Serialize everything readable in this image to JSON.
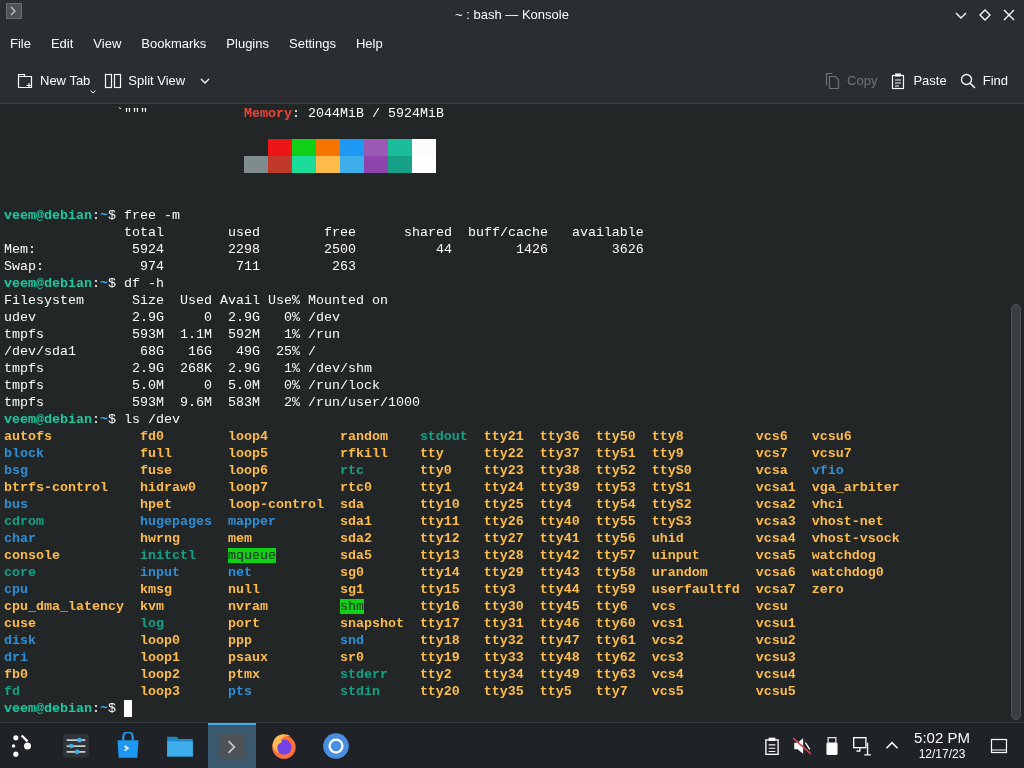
{
  "window": {
    "title": "~ : bash — Konsole"
  },
  "menu": [
    "File",
    "Edit",
    "View",
    "Bookmarks",
    "Plugins",
    "Settings",
    "Help"
  ],
  "toolbar": {
    "left": [
      {
        "label": "New Tab",
        "kind": "new-tab",
        "disabled": false
      },
      {
        "label": "Split View",
        "kind": "split-view",
        "disabled": false
      }
    ],
    "right": [
      {
        "label": "Copy",
        "kind": "copy",
        "disabled": true
      },
      {
        "label": "Paste",
        "kind": "paste",
        "disabled": false
      },
      {
        "label": "Find",
        "kind": "find",
        "disabled": false
      }
    ]
  },
  "terminal": {
    "lines": [
      {
        "kind": "info",
        "art": "`\"\"\"",
        "key": "Memory",
        "value": ": 2044MiB / 5924MiB"
      },
      {
        "kind": "blank"
      },
      {
        "kind": "palette",
        "rows": [
          [
            {
              "color": "#ed1515"
            },
            {
              "color": "#11d116"
            },
            {
              "color": "#f67400"
            },
            {
              "color": "#1d99f3"
            },
            {
              "color": "#9b59b6"
            },
            {
              "color": "#1abc9c"
            },
            {
              "color": "#fcfcfc"
            }
          ],
          [
            {
              "color": "#7f8c8d"
            },
            {
              "color": "#c0392b"
            },
            {
              "color": "#1cdc9a"
            },
            {
              "color": "#fdbc4b"
            },
            {
              "color": "#3daee9"
            },
            {
              "color": "#8e44ad"
            },
            {
              "color": "#16a085"
            },
            {
              "color": "#ffffff"
            }
          ]
        ]
      },
      {
        "kind": "blank"
      },
      {
        "kind": "blank"
      },
      {
        "kind": "prompt",
        "user": "veem@debian",
        "sep": ":",
        "path": "~",
        "symbol": "$",
        "command": "free -m",
        "cursor": false
      },
      {
        "kind": "output",
        "text": "               total        used        free      shared  buff/cache   available"
      },
      {
        "kind": "output",
        "text": "Mem:            5924        2298        2500          44        1426        3626"
      },
      {
        "kind": "output",
        "text": "Swap:            974         711         263"
      },
      {
        "kind": "prompt",
        "user": "veem@debian",
        "sep": ":",
        "path": "~",
        "symbol": "$",
        "command": "df -h",
        "cursor": false
      },
      {
        "kind": "output",
        "text": "Filesystem      Size  Used Avail Use% Mounted on"
      },
      {
        "kind": "output",
        "text": "udev            2.9G     0  2.9G   0% /dev"
      },
      {
        "kind": "output",
        "text": "tmpfs           593M  1.1M  592M   1% /run"
      },
      {
        "kind": "output",
        "text": "/dev/sda1        68G   16G   49G  25% /"
      },
      {
        "kind": "output",
        "text": "tmpfs           2.9G  268K  2.9G   1% /dev/shm"
      },
      {
        "kind": "output",
        "text": "tmpfs           5.0M     0  5.0M   0% /run/lock"
      },
      {
        "kind": "output",
        "text": "tmpfs           593M  9.6M  583M   2% /run/user/1000"
      },
      {
        "kind": "prompt",
        "user": "veem@debian",
        "sep": ":",
        "path": "~",
        "symbol": "$",
        "command": "ls /dev",
        "cursor": false
      },
      {
        "kind": "listing",
        "rows": [
          [
            {
              "name": "autofs",
              "kind": "dev"
            },
            {
              "name": "fd0",
              "kind": "dev"
            },
            {
              "name": "loop4",
              "kind": "dev"
            },
            {
              "name": "random",
              "kind": "dev"
            },
            {
              "name": "stdout",
              "kind": "link"
            },
            {
              "name": "tty21",
              "kind": "dev"
            },
            {
              "name": "tty36",
              "kind": "dev"
            },
            {
              "name": "tty50",
              "kind": "dev"
            },
            {
              "name": "tty8",
              "kind": "dev"
            },
            {
              "name": "vcs6",
              "kind": "dev"
            },
            {
              "name": "vcsu6",
              "kind": "dev"
            }
          ],
          [
            {
              "name": "block",
              "kind": "dir"
            },
            {
              "name": "full",
              "kind": "dev"
            },
            {
              "name": "loop5",
              "kind": "dev"
            },
            {
              "name": "rfkill",
              "kind": "dev"
            },
            {
              "name": "tty",
              "kind": "dev"
            },
            {
              "name": "tty22",
              "kind": "dev"
            },
            {
              "name": "tty37",
              "kind": "dev"
            },
            {
              "name": "tty51",
              "kind": "dev"
            },
            {
              "name": "tty9",
              "kind": "dev"
            },
            {
              "name": "vcs7",
              "kind": "dev"
            },
            {
              "name": "vcsu7",
              "kind": "dev"
            }
          ],
          [
            {
              "name": "bsg",
              "kind": "dir"
            },
            {
              "name": "fuse",
              "kind": "dev"
            },
            {
              "name": "loop6",
              "kind": "dev"
            },
            {
              "name": "rtc",
              "kind": "link"
            },
            {
              "name": "tty0",
              "kind": "dev"
            },
            {
              "name": "tty23",
              "kind": "dev"
            },
            {
              "name": "tty38",
              "kind": "dev"
            },
            {
              "name": "tty52",
              "kind": "dev"
            },
            {
              "name": "ttyS0",
              "kind": "dev"
            },
            {
              "name": "vcsa",
              "kind": "dev"
            },
            {
              "name": "vfio",
              "kind": "dir"
            }
          ],
          [
            {
              "name": "btrfs-control",
              "kind": "dev"
            },
            {
              "name": "hidraw0",
              "kind": "dev"
            },
            {
              "name": "loop7",
              "kind": "dev"
            },
            {
              "name": "rtc0",
              "kind": "dev"
            },
            {
              "name": "tty1",
              "kind": "dev"
            },
            {
              "name": "tty24",
              "kind": "dev"
            },
            {
              "name": "tty39",
              "kind": "dev"
            },
            {
              "name": "tty53",
              "kind": "dev"
            },
            {
              "name": "ttyS1",
              "kind": "dev"
            },
            {
              "name": "vcsa1",
              "kind": "dev"
            },
            {
              "name": "vga_arbiter",
              "kind": "dev"
            }
          ],
          [
            {
              "name": "bus",
              "kind": "dir"
            },
            {
              "name": "hpet",
              "kind": "dev"
            },
            {
              "name": "loop-control",
              "kind": "dev"
            },
            {
              "name": "sda",
              "kind": "dev"
            },
            {
              "name": "tty10",
              "kind": "dev"
            },
            {
              "name": "tty25",
              "kind": "dev"
            },
            {
              "name": "tty4",
              "kind": "dev"
            },
            {
              "name": "tty54",
              "kind": "dev"
            },
            {
              "name": "ttyS2",
              "kind": "dev"
            },
            {
              "name": "vcsa2",
              "kind": "dev"
            },
            {
              "name": "vhci",
              "kind": "dev"
            }
          ],
          [
            {
              "name": "cdrom",
              "kind": "link"
            },
            {
              "name": "hugepages",
              "kind": "dir"
            },
            {
              "name": "mapper",
              "kind": "dir"
            },
            {
              "name": "sda1",
              "kind": "dev"
            },
            {
              "name": "tty11",
              "kind": "dev"
            },
            {
              "name": "tty26",
              "kind": "dev"
            },
            {
              "name": "tty40",
              "kind": "dev"
            },
            {
              "name": "tty55",
              "kind": "dev"
            },
            {
              "name": "ttyS3",
              "kind": "dev"
            },
            {
              "name": "vcsa3",
              "kind": "dev"
            },
            {
              "name": "vhost-net",
              "kind": "dev"
            }
          ],
          [
            {
              "name": "char",
              "kind": "dir"
            },
            {
              "name": "hwrng",
              "kind": "dev"
            },
            {
              "name": "mem",
              "kind": "dev"
            },
            {
              "name": "sda2",
              "kind": "dev"
            },
            {
              "name": "tty12",
              "kind": "dev"
            },
            {
              "name": "tty27",
              "kind": "dev"
            },
            {
              "name": "tty41",
              "kind": "dev"
            },
            {
              "name": "tty56",
              "kind": "dev"
            },
            {
              "name": "uhid",
              "kind": "dev"
            },
            {
              "name": "vcsa4",
              "kind": "dev"
            },
            {
              "name": "vhost-vsock",
              "kind": "dev"
            }
          ],
          [
            {
              "name": "console",
              "kind": "dev"
            },
            {
              "name": "initctl",
              "kind": "link"
            },
            {
              "name": "mqueue",
              "kind": "sticky"
            },
            {
              "name": "sda5",
              "kind": "dev"
            },
            {
              "name": "tty13",
              "kind": "dev"
            },
            {
              "name": "tty28",
              "kind": "dev"
            },
            {
              "name": "tty42",
              "kind": "dev"
            },
            {
              "name": "tty57",
              "kind": "dev"
            },
            {
              "name": "uinput",
              "kind": "dev"
            },
            {
              "name": "vcsa5",
              "kind": "dev"
            },
            {
              "name": "watchdog",
              "kind": "dev"
            }
          ],
          [
            {
              "name": "core",
              "kind": "link"
            },
            {
              "name": "input",
              "kind": "dir"
            },
            {
              "name": "net",
              "kind": "dir"
            },
            {
              "name": "sg0",
              "kind": "dev"
            },
            {
              "name": "tty14",
              "kind": "dev"
            },
            {
              "name": "tty29",
              "kind": "dev"
            },
            {
              "name": "tty43",
              "kind": "dev"
            },
            {
              "name": "tty58",
              "kind": "dev"
            },
            {
              "name": "urandom",
              "kind": "dev"
            },
            {
              "name": "vcsa6",
              "kind": "dev"
            },
            {
              "name": "watchdog0",
              "kind": "dev"
            }
          ],
          [
            {
              "name": "cpu",
              "kind": "dir"
            },
            {
              "name": "kmsg",
              "kind": "dev"
            },
            {
              "name": "null",
              "kind": "dev"
            },
            {
              "name": "sg1",
              "kind": "dev"
            },
            {
              "name": "tty15",
              "kind": "dev"
            },
            {
              "name": "tty3",
              "kind": "dev"
            },
            {
              "name": "tty44",
              "kind": "dev"
            },
            {
              "name": "tty59",
              "kind": "dev"
            },
            {
              "name": "userfaultfd",
              "kind": "dev"
            },
            {
              "name": "vcsa7",
              "kind": "dev"
            },
            {
              "name": "zero",
              "kind": "dev"
            }
          ],
          [
            {
              "name": "cpu_dma_latency",
              "kind": "dev"
            },
            {
              "name": "kvm",
              "kind": "dev"
            },
            {
              "name": "nvram",
              "kind": "dev"
            },
            {
              "name": "shm",
              "kind": "sticky"
            },
            {
              "name": "tty16",
              "kind": "dev"
            },
            {
              "name": "tty30",
              "kind": "dev"
            },
            {
              "name": "tty45",
              "kind": "dev"
            },
            {
              "name": "tty6",
              "kind": "dev"
            },
            {
              "name": "vcs",
              "kind": "dev"
            },
            {
              "name": "vcsu",
              "kind": "dev"
            }
          ],
          [
            {
              "name": "cuse",
              "kind": "dev"
            },
            {
              "name": "log",
              "kind": "link"
            },
            {
              "name": "port",
              "kind": "dev"
            },
            {
              "name": "snapshot",
              "kind": "dev"
            },
            {
              "name": "tty17",
              "kind": "dev"
            },
            {
              "name": "tty31",
              "kind": "dev"
            },
            {
              "name": "tty46",
              "kind": "dev"
            },
            {
              "name": "tty60",
              "kind": "dev"
            },
            {
              "name": "vcs1",
              "kind": "dev"
            },
            {
              "name": "vcsu1",
              "kind": "dev"
            }
          ],
          [
            {
              "name": "disk",
              "kind": "dir"
            },
            {
              "name": "loop0",
              "kind": "dev"
            },
            {
              "name": "ppp",
              "kind": "dev"
            },
            {
              "name": "snd",
              "kind": "dir"
            },
            {
              "name": "tty18",
              "kind": "dev"
            },
            {
              "name": "tty32",
              "kind": "dev"
            },
            {
              "name": "tty47",
              "kind": "dev"
            },
            {
              "name": "tty61",
              "kind": "dev"
            },
            {
              "name": "vcs2",
              "kind": "dev"
            },
            {
              "name": "vcsu2",
              "kind": "dev"
            }
          ],
          [
            {
              "name": "dri",
              "kind": "dir"
            },
            {
              "name": "loop1",
              "kind": "dev"
            },
            {
              "name": "psaux",
              "kind": "dev"
            },
            {
              "name": "sr0",
              "kind": "dev"
            },
            {
              "name": "tty19",
              "kind": "dev"
            },
            {
              "name": "tty33",
              "kind": "dev"
            },
            {
              "name": "tty48",
              "kind": "dev"
            },
            {
              "name": "tty62",
              "kind": "dev"
            },
            {
              "name": "vcs3",
              "kind": "dev"
            },
            {
              "name": "vcsu3",
              "kind": "dev"
            }
          ],
          [
            {
              "name": "fb0",
              "kind": "dev"
            },
            {
              "name": "loop2",
              "kind": "dev"
            },
            {
              "name": "ptmx",
              "kind": "dev"
            },
            {
              "name": "stderr",
              "kind": "link"
            },
            {
              "name": "tty2",
              "kind": "dev"
            },
            {
              "name": "tty34",
              "kind": "dev"
            },
            {
              "name": "tty49",
              "kind": "dev"
            },
            {
              "name": "tty63",
              "kind": "dev"
            },
            {
              "name": "vcs4",
              "kind": "dev"
            },
            {
              "name": "vcsu4",
              "kind": "dev"
            }
          ],
          [
            {
              "name": "fd",
              "kind": "link"
            },
            {
              "name": "loop3",
              "kind": "dev"
            },
            {
              "name": "pts",
              "kind": "dir"
            },
            {
              "name": "stdin",
              "kind": "link"
            },
            {
              "name": "tty20",
              "kind": "dev"
            },
            {
              "name": "tty35",
              "kind": "dev"
            },
            {
              "name": "tty5",
              "kind": "dev"
            },
            {
              "name": "tty7",
              "kind": "dev"
            },
            {
              "name": "vcs5",
              "kind": "dev"
            },
            {
              "name": "vcsu5",
              "kind": "dev"
            }
          ]
        ]
      },
      {
        "kind": "prompt",
        "user": "veem@debian",
        "sep": ":",
        "path": "~",
        "symbol": "$",
        "cursor": true
      }
    ]
  },
  "taskbar": {
    "apps": [
      {
        "kind": "launcher",
        "selected": false
      },
      {
        "kind": "settings",
        "selected": false
      },
      {
        "kind": "store",
        "selected": false
      },
      {
        "kind": "files",
        "selected": false
      },
      {
        "kind": "terminal",
        "selected": true
      },
      {
        "kind": "firefox",
        "selected": false
      },
      {
        "kind": "browser",
        "selected": false
      }
    ],
    "tray": [
      {
        "kind": "clipboard"
      },
      {
        "kind": "muted"
      },
      {
        "kind": "usb"
      },
      {
        "kind": "network"
      },
      {
        "kind": "expand"
      }
    ],
    "time": "5:02 PM",
    "date": "12/17/23"
  }
}
